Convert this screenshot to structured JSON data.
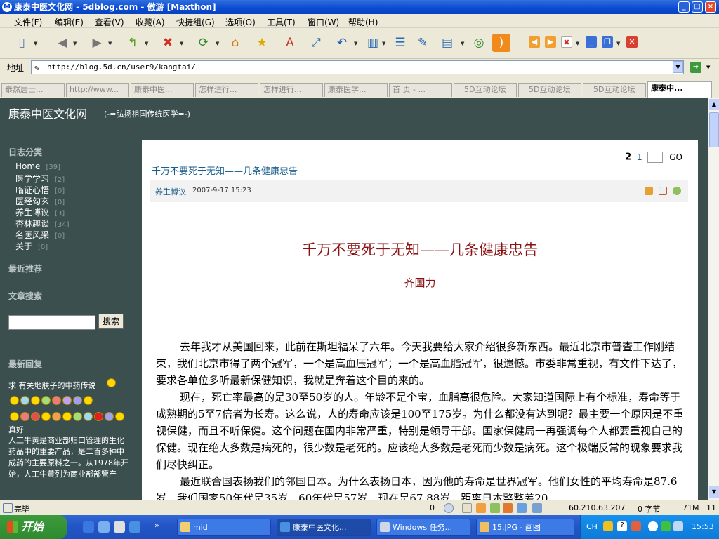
{
  "window": {
    "title": "康泰中医文化网 - 5dblog.com - 傲游 [Maxthon]"
  },
  "menu": [
    "文件(F)",
    "编辑(E)",
    "查看(V)",
    "收藏(A)",
    "快捷组(G)",
    "选项(O)",
    "工具(T)",
    "窗口(W)",
    "帮助(H)"
  ],
  "address": {
    "label": "地址",
    "url": "http://blog.5d.cn/user9/kangtai/"
  },
  "tabs": [
    "泰然居士...",
    "http://www...",
    "康泰中医...",
    "怎样进行...",
    "怎样进行...",
    "康泰医学...",
    "首 页 - ...",
    "5D互动论坛",
    "5D互动论坛",
    "5D互动论坛",
    "康泰中..."
  ],
  "blog": {
    "title": "康泰中医文化网",
    "subtitle": "(-=弘扬祖国传统医学=-)"
  },
  "sidebar": {
    "cat_heading": "日志分类",
    "categories": [
      {
        "label": "Home",
        "count": "[39]"
      },
      {
        "label": "医学学习",
        "count": "[2]"
      },
      {
        "label": "临证心悟",
        "count": "[0]"
      },
      {
        "label": "医经勾玄",
        "count": "[0]"
      },
      {
        "label": "养生博议",
        "count": "[3]"
      },
      {
        "label": "杏林趣谈",
        "count": "[34]"
      },
      {
        "label": "名医风采",
        "count": "[0]"
      },
      {
        "label": "关于",
        "count": "[0]"
      }
    ],
    "recommend_heading": "最近推荐",
    "search_heading": "文章搜索",
    "search_button": "搜索",
    "reply_heading": "最新回复",
    "reply1": "求 有关地肤子的中药传说",
    "reply2": "真好",
    "reply3": "人工牛黄是商业部归口管理的生化药品中的重要产品，是二百多种中成药的主要原料之一。从1978年开始，人工牛黄列为商业部部管产"
  },
  "pager": {
    "page2": "2",
    "page1": "1",
    "go": "GO"
  },
  "post": {
    "title": "千万不要死于无知——几条健康忠告",
    "category": "养生博议",
    "date": "2007-9-17 15:23",
    "headline": "千万不要死于无知——几条健康忠告",
    "author": "齐国力",
    "p1": "去年我才从美国回来，此前在斯坦福呆了六年。今天我要给大家介绍很多新东西。最近北京市普查工作刚结束，我们北京市得了两个冠军，一个是高血压冠军；一个是高血脂冠军，很遗憾。市委非常重视，有文件下达了，要求各单位多听最新保健知识，我就是奔着这个目的来的。",
    "p2": "现在，死亡率最高的是30至50岁的人。年龄不是个宝，血脂高很危险。大家知道国际上有个标准，寿命等于成熟期的5至7倍者为长寿。这么说，人的寿命应该是100至175岁。为什么都没有达到呢？最主要一个原因是不重视保健，而且不听保健。这个问题在国内非常严重，特别是领导干部。国家保健局一再强调每个人都要重视自己的保健。现在绝大多数是病死的，很少数是老死的。应该绝大多数是老死而少数是病死。这个极端反常的现象要求我们尽快纠正。",
    "p3": "最近联合国表扬我们的邻国日本。为什么表扬日本，因为他的寿命是世界冠军。他们女性的平均寿命是87.6岁，我们国家50年代是35岁，60年代是57岁，现在是67.88岁，距离日本整整差20"
  },
  "status": {
    "text": "完毕",
    "ip": "60.210.63.207",
    "bytes": "0 字节",
    "mem": "71M",
    "num": "11",
    "counter": "0"
  },
  "taskbar": {
    "start": "开始",
    "tasks": [
      "mid",
      "康泰中医文化...",
      "Windows 任务...",
      "15.JPG - 画图"
    ],
    "lang": "CH",
    "clock": "15:53"
  },
  "colors": {
    "page_bg": "#3c4f4f",
    "title_red": "#8b1212",
    "link_blue": "#1b5e8c",
    "xp_blue": "#0a4ad0"
  }
}
